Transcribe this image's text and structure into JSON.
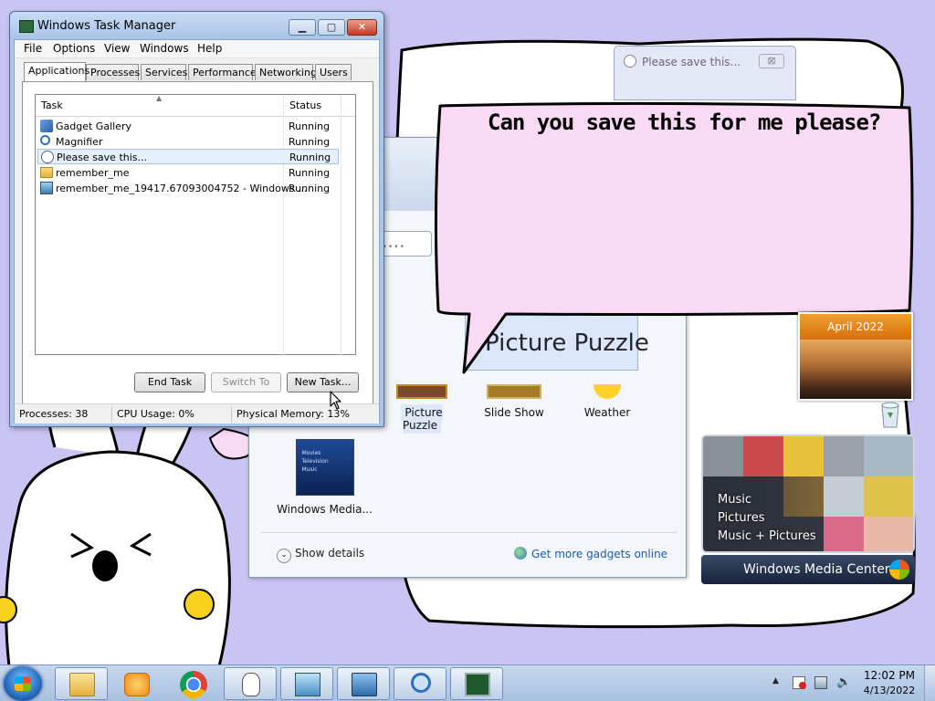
{
  "task_manager": {
    "title": "Windows Task Manager",
    "menu": [
      "File",
      "Options",
      "View",
      "Windows",
      "Help"
    ],
    "tabs": [
      "Applications",
      "Processes",
      "Services",
      "Performance",
      "Networking",
      "Users"
    ],
    "active_tab": "Applications",
    "columns": [
      "Task",
      "Status"
    ],
    "tasks": [
      {
        "name": "Gadget Gallery",
        "status": "Running",
        "icon": "gadget-gallery-icon"
      },
      {
        "name": "Magnifier",
        "status": "Running",
        "icon": "magnifier-icon"
      },
      {
        "name": "Please save this...",
        "status": "Running",
        "icon": "bunny-icon",
        "selected": true
      },
      {
        "name": "remember_me",
        "status": "Running",
        "icon": "folder-icon"
      },
      {
        "name": "remember_me_19417.67093004752 - Windows ...",
        "status": "Running",
        "icon": "photo-viewer-icon"
      }
    ],
    "buttons": {
      "end_task": "End Task",
      "switch_to": "Switch To",
      "new_task": "New Task..."
    },
    "status": {
      "processes": "Processes: 38",
      "cpu": "CPU Usage: 0%",
      "memory": "Physical Memory: 13%"
    }
  },
  "save_dialog": {
    "title": "Please save this...",
    "close": "⊠"
  },
  "speech_bubble": {
    "text": "Can you save this for me please?"
  },
  "gadget_gallery": {
    "search_text": "....",
    "selected_gadget": "Picture Puzzle",
    "items": [
      "Picture Puzzle",
      "Slide Show",
      "Weather",
      "Windows Media..."
    ],
    "wmc_thumb_lines": [
      "Movies",
      "Television",
      "Music"
    ],
    "show_details": "Show details",
    "get_more": "Get more gadgets online"
  },
  "calendar_gadget": {
    "month": "April 2022"
  },
  "media_center_gadget": {
    "items": [
      "Music",
      "Pictures",
      "Music + Pictures"
    ],
    "bar_label": "Windows Media Center"
  },
  "taskbar": {
    "time": "12:02 PM",
    "date": "4/13/2022",
    "apps": [
      "file-explorer-icon",
      "media-player-icon",
      "chrome-icon",
      "bunny-app-icon",
      "photo-viewer-icon",
      "network-icon",
      "magnifier-icon",
      "task-manager-icon"
    ]
  },
  "colors": {
    "bubble_fill": "#f9d9f3",
    "desktop": "#c9c4f2",
    "selection": "#e5f0fb",
    "link": "#1a5bb7"
  }
}
